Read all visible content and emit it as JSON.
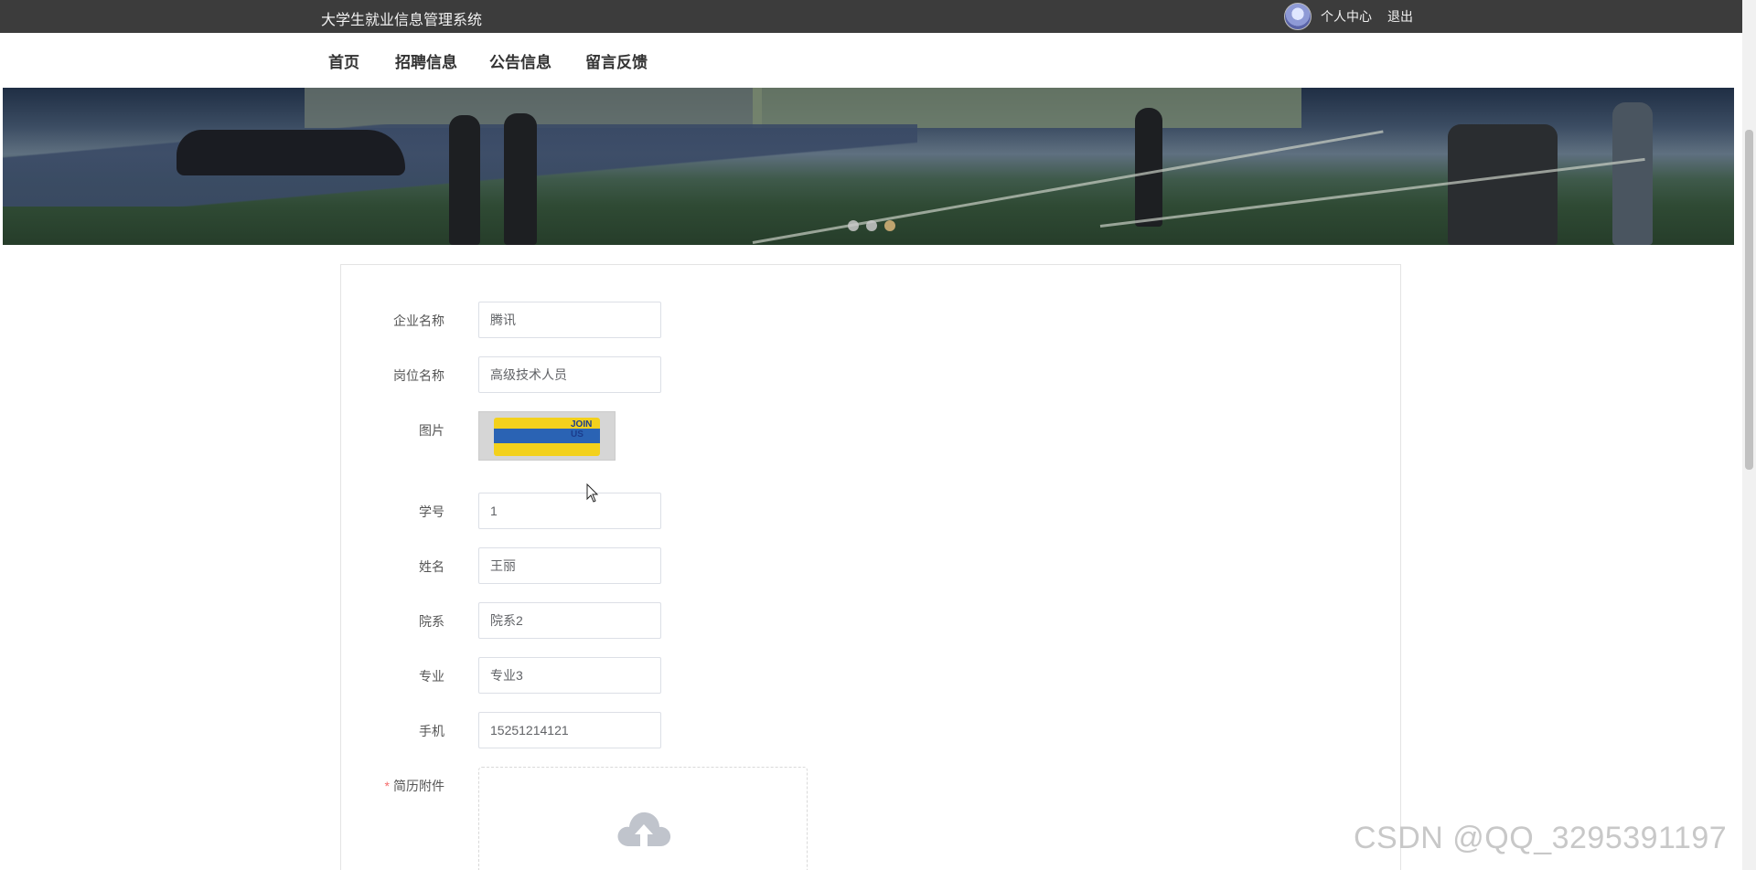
{
  "header": {
    "system_title": "大学生就业信息管理系统",
    "personal_center": "个人中心",
    "logout": "退出"
  },
  "nav": {
    "items": [
      {
        "label": "首页"
      },
      {
        "label": "招聘信息"
      },
      {
        "label": "公告信息"
      },
      {
        "label": "留言反馈"
      }
    ]
  },
  "banner": {
    "dot_count": 3,
    "active_dot": 3
  },
  "form": {
    "company_name": {
      "label": "企业名称",
      "value": "腾讯"
    },
    "position_name": {
      "label": "岗位名称",
      "value": "高级技术人员"
    },
    "image": {
      "label": "图片",
      "thumb_text": "JOIN US"
    },
    "student_id": {
      "label": "学号",
      "value": "1"
    },
    "name": {
      "label": "姓名",
      "value": "王丽"
    },
    "department": {
      "label": "院系",
      "value": "院系2"
    },
    "major": {
      "label": "专业",
      "value": "专业3"
    },
    "phone": {
      "label": "手机",
      "value": "15251214121"
    },
    "resume": {
      "label": "简历附件",
      "required_mark": "*"
    }
  },
  "watermark": "CSDN @QQ_3295391197",
  "colors": {
    "topbar": "#3c3c3c",
    "active_dot": "#d9b57a",
    "required": "#f56c6c"
  }
}
